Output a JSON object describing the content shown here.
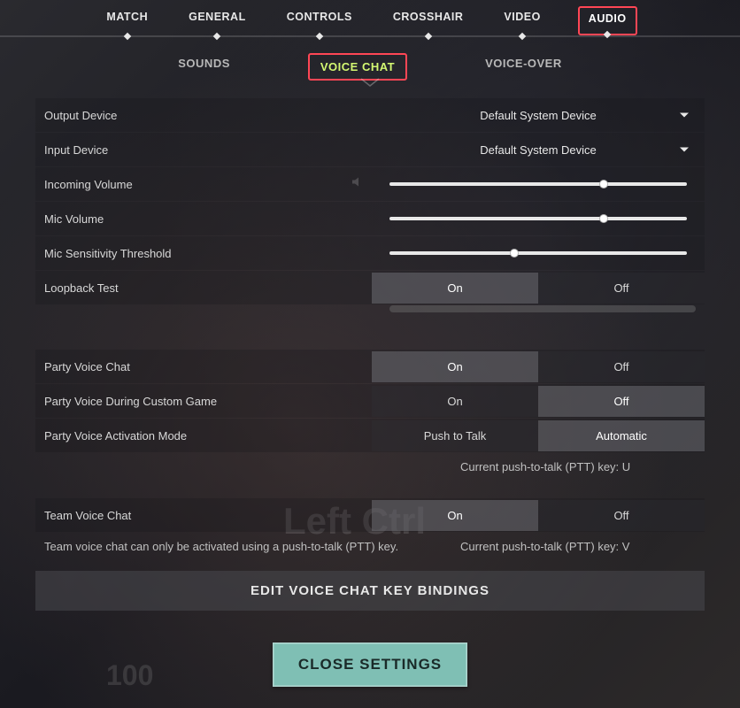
{
  "topTabs": {
    "match": "MATCH",
    "general": "GENERAL",
    "controls": "CONTROLS",
    "crosshair": "CROSSHAIR",
    "video": "VIDEO",
    "audio": "AUDIO"
  },
  "subTabs": {
    "sounds": "SOUNDS",
    "voiceChat": "VOICE CHAT",
    "voiceOver": "VOICE-OVER"
  },
  "labels": {
    "outputDevice": "Output Device",
    "inputDevice": "Input Device",
    "incomingVolume": "Incoming Volume",
    "micVolume": "Mic Volume",
    "micSensitivity": "Mic Sensitivity Threshold",
    "loopbackTest": "Loopback Test",
    "partyVoiceChat": "Party Voice Chat",
    "partyVoiceDuringCustom": "Party Voice During Custom Game",
    "partyVoiceActivation": "Party Voice Activation Mode",
    "teamVoiceChat": "Team Voice Chat"
  },
  "values": {
    "outputDevice": "Default System Device",
    "inputDevice": "Default System Device",
    "incomingVolumePct": 72,
    "micVolumePct": 72,
    "micSensitivityPct": 42,
    "loopbackTest": "On",
    "partyVoiceChat": "On",
    "partyVoiceDuringCustom": "Off",
    "partyVoiceActivation": "Automatic",
    "teamVoiceChat": "On"
  },
  "toggles": {
    "on": "On",
    "off": "Off",
    "pushToTalk": "Push to Talk",
    "automatic": "Automatic"
  },
  "info": {
    "partyPttKey": "Current push-to-talk (PTT) key: U",
    "teamPttNote": "Team voice chat can only be activated using a push-to-talk (PTT) key.",
    "teamPttKey": "Current push-to-talk (PTT) key: V"
  },
  "buttons": {
    "editBindings": "EDIT VOICE CHAT KEY BINDINGS",
    "close": "CLOSE SETTINGS"
  },
  "ghost": {
    "leftCtrl": "Left Ctrl",
    "hundred": "100"
  }
}
